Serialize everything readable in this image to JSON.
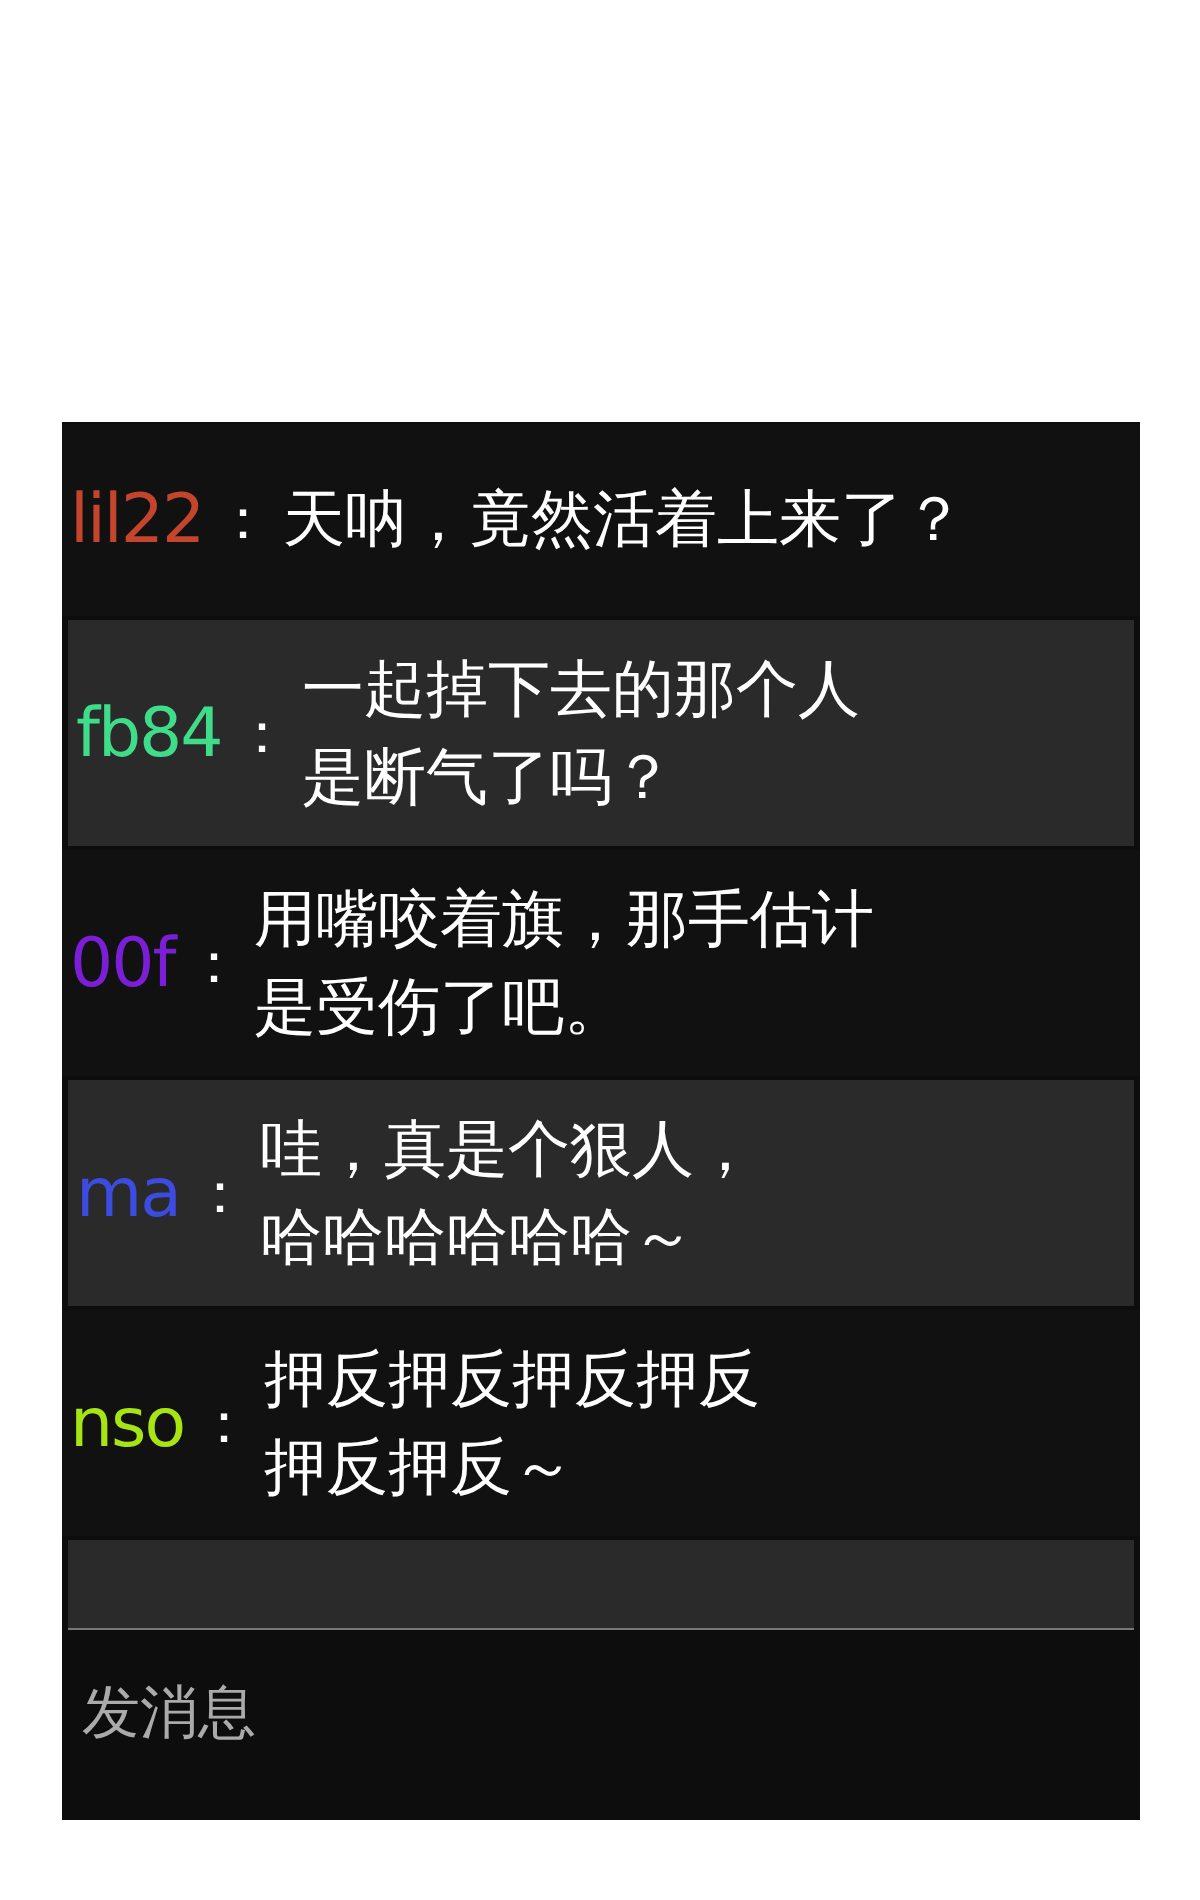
{
  "messages": [
    {
      "sender": "lil22",
      "color": "#c4452c",
      "separator": "：",
      "lines": [
        "天呐，竟然活着上来了？"
      ]
    },
    {
      "sender": "fb84",
      "color": "#3fdc8a",
      "separator": "：",
      "lines": [
        "一起掉下去的那个人",
        "是断气了吗？"
      ]
    },
    {
      "sender": "00f",
      "color": "#7b1fd6",
      "separator": "：",
      "lines": [
        "用嘴咬着旗，那手估计",
        "是受伤了吧。"
      ]
    },
    {
      "sender": "ma",
      "color": "#3c4be0",
      "separator": "：",
      "lines": [
        "哇，真是个狠人，",
        "哈哈哈哈哈哈～"
      ]
    },
    {
      "sender": "nso",
      "color": "#a6e414",
      "separator": "：",
      "lines": [
        "押反押反押反押反",
        "押反押反～"
      ]
    }
  ],
  "input": {
    "placeholder": "发消息"
  }
}
